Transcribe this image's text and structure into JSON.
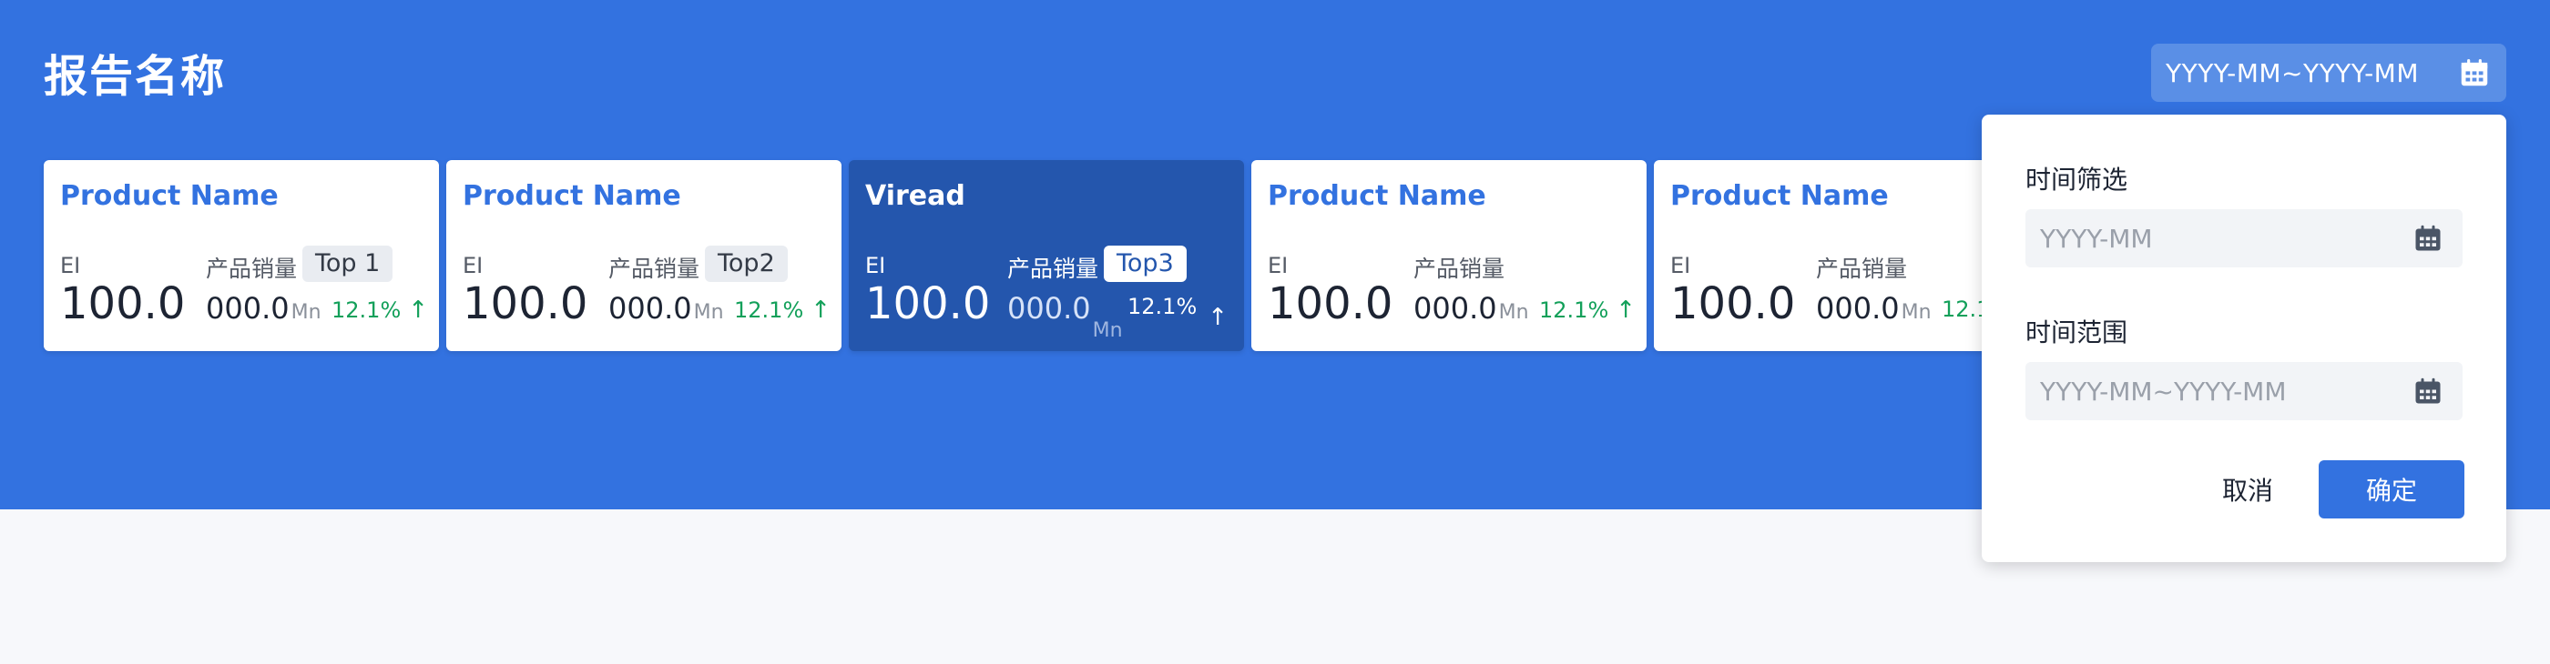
{
  "header": {
    "title": "报告名称",
    "date_range_placeholder": "YYYY-MM~YYYY-MM"
  },
  "cards": [
    {
      "name": "Product Name",
      "ei_label": "EI",
      "ei_value": "100.0",
      "sales_label": "产品销量",
      "badge": "Top 1",
      "sales_value": "000.0",
      "unit": "Mn",
      "growth": "12.1%",
      "arrow": "↑",
      "active": false
    },
    {
      "name": "Product Name",
      "ei_label": "EI",
      "ei_value": "100.0",
      "sales_label": "产品销量",
      "badge": "Top2",
      "sales_value": "000.0",
      "unit": "Mn",
      "growth": "12.1%",
      "arrow": "↑",
      "active": false
    },
    {
      "name": "Viread",
      "ei_label": "EI",
      "ei_value": "100.0",
      "sales_label": "产品销量",
      "badge": "Top3",
      "sales_value": "000.0",
      "unit": "Mn",
      "growth": "12.1%",
      "arrow": "↑",
      "active": true
    },
    {
      "name": "Product Name",
      "ei_label": "EI",
      "ei_value": "100.0",
      "sales_label": "产品销量",
      "sales_value": "000.0",
      "unit": "Mn",
      "growth": "12.1%",
      "arrow": "↑",
      "active": false
    },
    {
      "name": "Product Name",
      "ei_label": "EI",
      "ei_value": "100.0",
      "sales_label": "产品销量",
      "sales_value": "000.0",
      "unit": "Mn",
      "growth": "12.1",
      "active": false
    }
  ],
  "filter_popover": {
    "time_filter_label": "时间筛选",
    "month_placeholder": "YYYY-MM",
    "time_range_label": "时间范围",
    "range_placeholder": "YYYY-MM~YYYY-MM",
    "cancel_label": "取消",
    "confirm_label": "确定"
  },
  "colors": {
    "primary": "#3372e0",
    "active_card": "#2456ad",
    "growth_green": "#13a05a"
  },
  "icons": [
    "calendar-icon",
    "arrow-up-icon"
  ]
}
